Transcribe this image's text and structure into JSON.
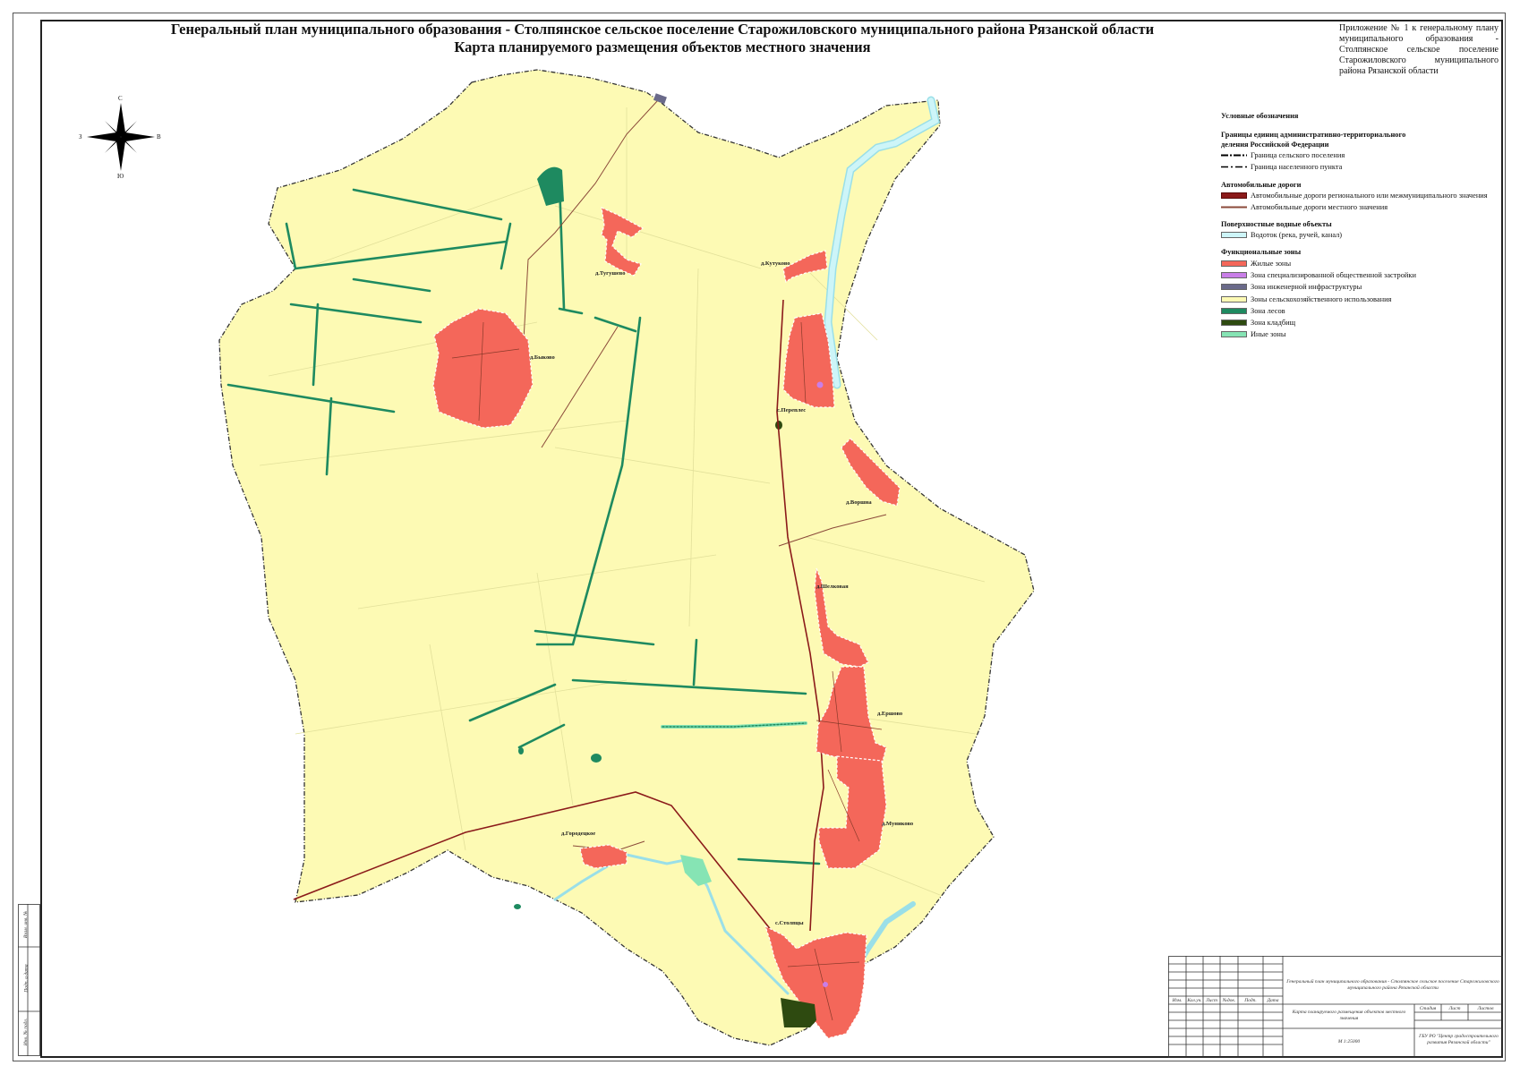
{
  "title": {
    "line1": "Генеральный план муниципального образования - Столпянское сельское поселение Старожиловского муниципального района Рязанской области",
    "line2": "Карта планируемого размещения объектов местного значения"
  },
  "annex": "Приложение № 1 к генеральному плану муниципального образования - Столпянское сельское поселение Старожиловского муниципального района Рязанской области",
  "compass": {
    "n": "С",
    "s": "Ю",
    "w": "З",
    "e": "В"
  },
  "legend": {
    "title": "Условные обозначения",
    "boundaries": {
      "heading": "Границы единиц административно-территориального деления Российской Федерации",
      "items": [
        "Граница сельского поселения",
        "Граница населенного пункта"
      ]
    },
    "roads": {
      "heading": "Автомобильные дороги",
      "items": [
        {
          "label": "Автомобильные дороги регионального или межмуниципального значения",
          "color": "#8b1a1a"
        },
        {
          "label": "Автомобильные дороги местного значения",
          "color": "#8b4a3a"
        }
      ]
    },
    "water": {
      "heading": "Поверхностные водные объекты",
      "items": [
        {
          "label": "Водоток (река, ручей, канал)",
          "color": "#cdf5f8"
        }
      ]
    },
    "zones": {
      "heading": "Функциональные зоны",
      "items": [
        {
          "label": "Жилые зоны",
          "color": "#f4675a"
        },
        {
          "label": "Зона специализированной общественной застройки",
          "color": "#c97ee8"
        },
        {
          "label": "Зона инженерной инфраструктуры",
          "color": "#6a6a8a"
        },
        {
          "label": "Зоны сельскохозяйственного использования",
          "color": "#fdfab4"
        },
        {
          "label": "Зона лесов",
          "color": "#1e8a60"
        },
        {
          "label": "Зона кладбищ",
          "color": "#2e4a10"
        },
        {
          "label": "Иные зоны",
          "color": "#86e4b4"
        }
      ]
    }
  },
  "villages": [
    "д.Тугушево",
    "д.Кутуково",
    "д.Быково",
    "с.Переплес",
    "д.Воршна",
    "д.Шелковая",
    "д.Ершово",
    "д.Муниково",
    "д.Городецкое",
    "с.Столпцы"
  ],
  "stamp": {
    "project": "Генеральный план муниципального образования - Столпянское сельское поселение Старожиловского муниципального района Рязанской области",
    "sheet": "Карта планируемого размещения объектов местного значения",
    "scale": "М 1:25000",
    "org": "ГБУ РО \"Центр градостроительного развития Рязанской области\"",
    "cols": [
      "Изм.",
      "Кол.уч.",
      "Лист",
      "№док.",
      "Подп.",
      "Дата"
    ],
    "stage_cols": [
      "Стадия",
      "Лист",
      "Листов"
    ],
    "side": [
      "Инв. № подл.",
      "Подп. и дата",
      "Взам. инв. №"
    ]
  },
  "colors": {
    "agri": "#fdfab4",
    "residential": "#f4675a",
    "forest": "#1e8a60",
    "river": "#cdf5f8",
    "road_regional": "#8b1a1a",
    "road_local": "#8b4a3a"
  }
}
